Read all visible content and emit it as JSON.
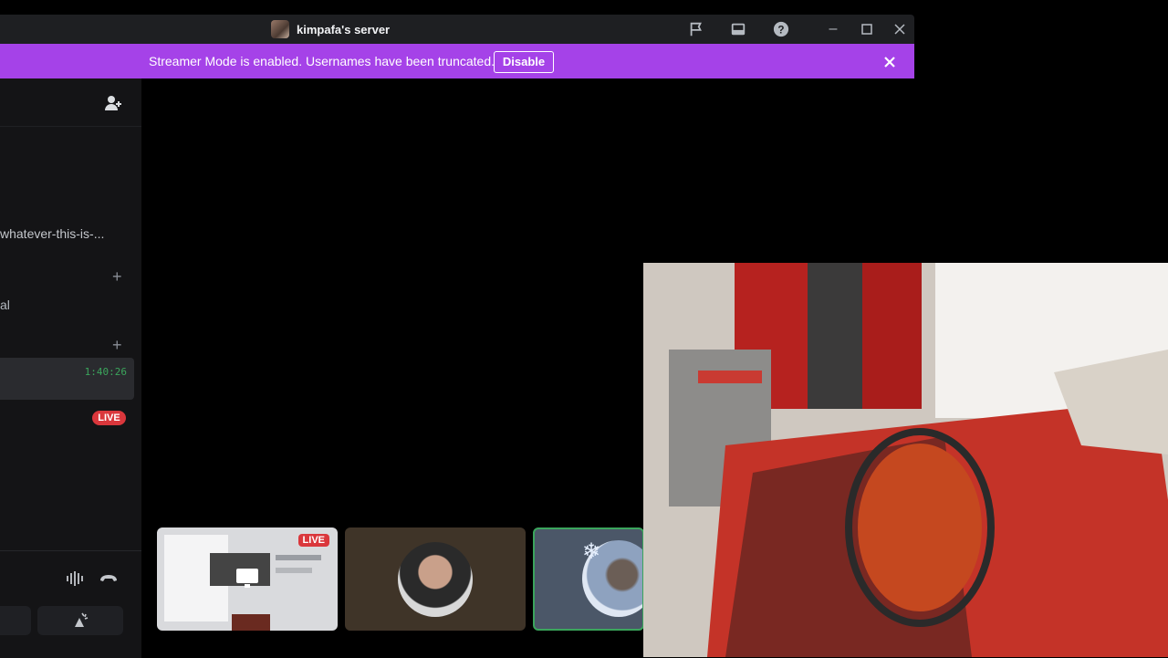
{
  "titlebar": {
    "server_name": "kimpafa's server",
    "icons": [
      "flag-icon",
      "inbox-icon",
      "help-icon"
    ],
    "window_controls": [
      "minimize-icon",
      "maximize-icon",
      "close-icon"
    ]
  },
  "banner": {
    "message": "Streamer Mode is enabled. Usernames have been truncated.",
    "button": "Disable",
    "color": "#a542e8"
  },
  "sidebar": {
    "channel_text": "whatever-this-is-...",
    "channel_text_2": "al",
    "voice_timer": "1:40:26",
    "live_badge": "LIVE"
  },
  "tiles": [
    {
      "type": "screen-share",
      "badge": "LIVE"
    },
    {
      "type": "avatar"
    },
    {
      "type": "avatar-speaking"
    }
  ],
  "colors": {
    "live": "#da373c",
    "speaking": "#3ba55c",
    "timer": "#3ba55c"
  }
}
